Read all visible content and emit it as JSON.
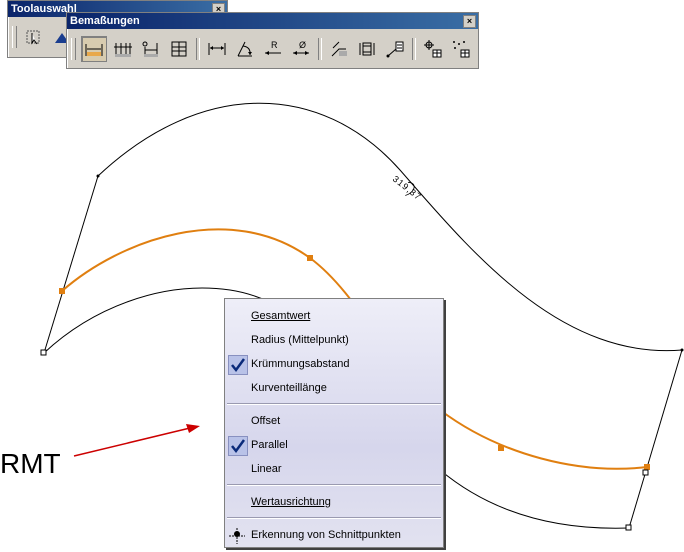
{
  "toolbars": {
    "tool_selection": {
      "title": "Toolauswahl",
      "close": "×"
    },
    "dimensions": {
      "title": "Bemaßungen",
      "close": "×",
      "buttons": [
        {
          "icon": "arc-length-dimension-icon",
          "active": true
        },
        {
          "icon": "chained-dimension-icon",
          "active": false
        },
        {
          "icon": "cumulated-dimension-icon",
          "active": false
        },
        {
          "icon": "stacked-dimension-icon",
          "active": false
        },
        {
          "icon": "length-dimension-icon",
          "active": false
        },
        {
          "icon": "angle-dimension-icon",
          "active": false
        },
        {
          "icon": "radius-dimension-icon",
          "active": false,
          "glyph": "R"
        },
        {
          "icon": "diameter-dimension-icon",
          "active": false,
          "glyph": "Ø"
        },
        {
          "icon": "chamfer-dimension-icon",
          "active": false
        },
        {
          "icon": "thread-dimension-icon",
          "active": false
        },
        {
          "icon": "coordinate-dimension-icon",
          "active": false
        },
        {
          "icon": "hole-table-icon",
          "active": false
        },
        {
          "icon": "point-coordinate-table-icon",
          "active": false
        }
      ]
    }
  },
  "drawing": {
    "dimension_value": "319,37",
    "colors": {
      "curve": "#000000",
      "highlight": "#e07f10",
      "arrow": "#cc0000"
    }
  },
  "annotation": {
    "label": "RMT"
  },
  "context_menu": {
    "groups": [
      [
        {
          "label": "Gesamtwert",
          "checked": false
        },
        {
          "label": "Radius (Mittelpunkt)",
          "checked": false
        },
        {
          "label": "Krümmungsabstand",
          "checked": true
        },
        {
          "label": "Kurventeillänge",
          "checked": false
        }
      ],
      [
        {
          "label": "Offset",
          "checked": false
        },
        {
          "label": "Parallel",
          "checked": true
        },
        {
          "label": "Linear",
          "checked": false
        }
      ],
      [
        {
          "label": "Wertausrichtung",
          "checked": false
        }
      ],
      [
        {
          "label": "Erkennung von Schnittpunkten",
          "checked": false,
          "icon": "intersection-detection-icon"
        }
      ]
    ]
  }
}
